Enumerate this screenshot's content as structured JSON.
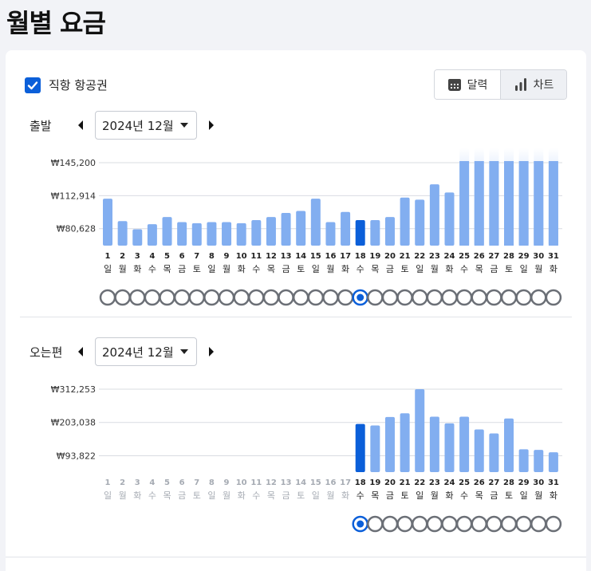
{
  "page": {
    "title": "월별 요금"
  },
  "options": {
    "direct_flight_label": "직항 항공권",
    "direct_flight_checked": true
  },
  "view_toggle": {
    "calendar_label": "달력",
    "chart_label": "차트",
    "active": "chart"
  },
  "colors": {
    "accent": "#0b5fd9",
    "bar": "#82aef0",
    "bar_selected": "#0b5fd9",
    "ring": "#6b6f76"
  },
  "day_numbers": [
    "1",
    "2",
    "3",
    "4",
    "5",
    "6",
    "7",
    "8",
    "9",
    "10",
    "11",
    "12",
    "13",
    "14",
    "15",
    "16",
    "17",
    "18",
    "19",
    "20",
    "21",
    "22",
    "23",
    "24",
    "25",
    "26",
    "27",
    "28",
    "29",
    "30",
    "31"
  ],
  "weekdays": [
    "일",
    "월",
    "화",
    "수",
    "목",
    "금",
    "토",
    "일",
    "월",
    "화",
    "수",
    "목",
    "금",
    "토",
    "일",
    "월",
    "화",
    "수",
    "목",
    "금",
    "토",
    "일",
    "월",
    "화",
    "수",
    "목",
    "금",
    "토",
    "일",
    "월",
    "화"
  ],
  "departure": {
    "label": "출발",
    "month": "2024년 12월",
    "selected_day": 18,
    "first_available_day": 1
  },
  "return": {
    "label": "오는편",
    "month": "2024년 12월",
    "selected_day": 18,
    "first_available_day": 18
  },
  "chart_data": [
    {
      "type": "bar",
      "name": "출발",
      "categories": [
        "1",
        "2",
        "3",
        "4",
        "5",
        "6",
        "7",
        "8",
        "9",
        "10",
        "11",
        "12",
        "13",
        "14",
        "15",
        "16",
        "17",
        "18",
        "19",
        "20",
        "21",
        "22",
        "23",
        "24",
        "25",
        "26",
        "27",
        "28",
        "29",
        "30",
        "31"
      ],
      "values": [
        110000,
        88000,
        80000,
        85000,
        92000,
        87000,
        86000,
        87000,
        87000,
        86000,
        89000,
        92000,
        96000,
        98000,
        110000,
        87000,
        97000,
        89000,
        89000,
        92000,
        111000,
        109000,
        124000,
        116000,
        160000,
        160000,
        160000,
        160000,
        160000,
        160000,
        160000
      ],
      "y_ticks": [
        "₩145,200",
        "₩112,914",
        "₩80,628"
      ],
      "y_tick_values": [
        145200,
        112914,
        80628
      ],
      "ylim": [
        64000,
        145200
      ],
      "clipped_from_day": 25
    },
    {
      "type": "bar",
      "name": "오는편",
      "categories": [
        "18",
        "19",
        "20",
        "21",
        "22",
        "23",
        "24",
        "25",
        "26",
        "27",
        "28",
        "29",
        "30",
        "31"
      ],
      "values": [
        198000,
        193000,
        221000,
        233000,
        312253,
        222000,
        200000,
        222000,
        180000,
        167000,
        216000,
        115000,
        113000,
        105000
      ],
      "y_ticks": [
        "₩312,253",
        "₩203,038",
        "₩93,822"
      ],
      "y_tick_values": [
        312253,
        203038,
        93822
      ],
      "ylim": [
        40000,
        312253
      ]
    }
  ]
}
